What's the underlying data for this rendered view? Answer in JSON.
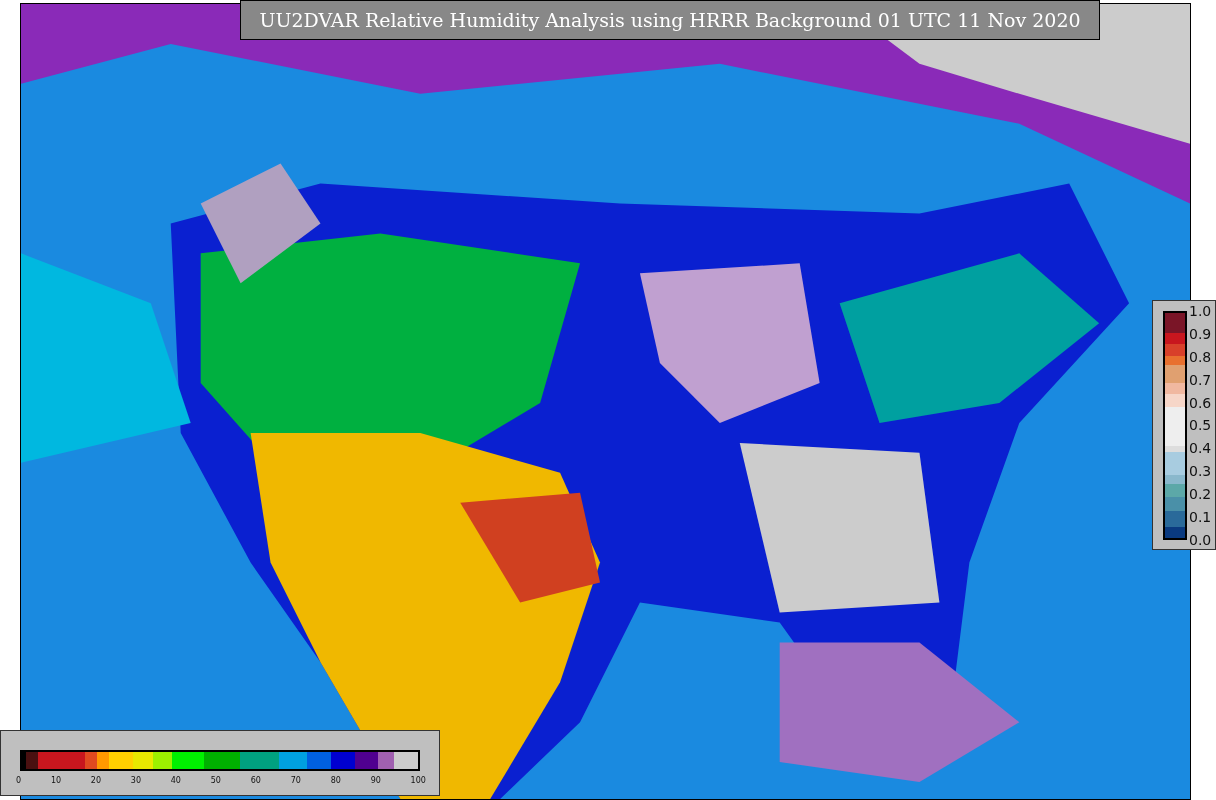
{
  "title": "UU2DVAR Relative Humidity Analysis using HRRR Background 01 UTC 11 Nov 2020",
  "fraction_colorbar": {
    "ticks": [
      "1.0",
      "0.9",
      "0.8",
      "0.7",
      "0.6",
      "0.5",
      "0.4",
      "0.3",
      "0.2",
      "0.1",
      "0.0"
    ]
  },
  "humidity_colorbar": {
    "ticks": [
      "0",
      "10",
      "20",
      "30",
      "40",
      "50",
      "60",
      "70",
      "80",
      "90",
      "100"
    ]
  }
}
